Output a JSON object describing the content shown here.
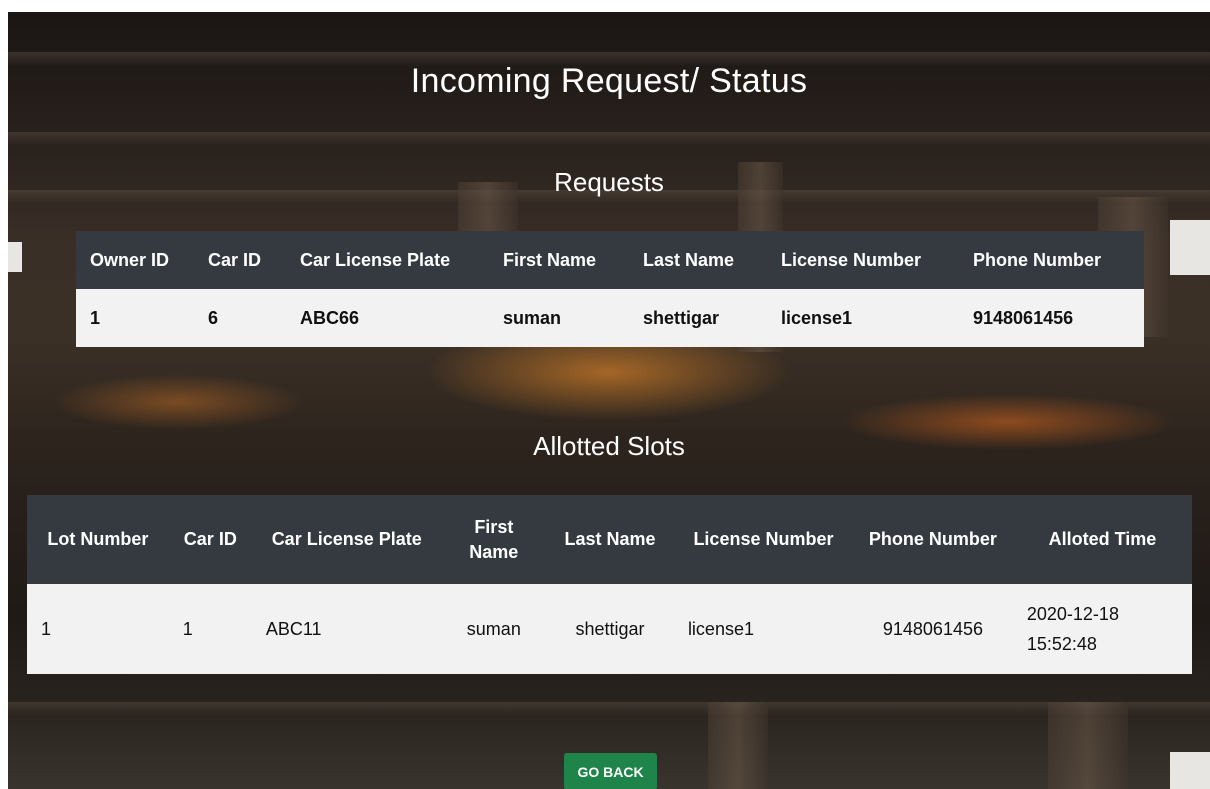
{
  "page": {
    "title": "Incoming Request/ Status"
  },
  "requests": {
    "heading": "Requests",
    "columns": [
      "Owner ID",
      "Car ID",
      "Car License Plate",
      "First Name",
      "Last Name",
      "License Number",
      "Phone Number"
    ],
    "rows": [
      [
        "1",
        "6",
        "ABC66",
        "suman",
        "shettigar",
        "license1",
        "9148061456"
      ]
    ]
  },
  "allotted": {
    "heading": "Allotted Slots",
    "columns": [
      "Lot Number",
      "Car ID",
      "Car License Plate",
      "First Name",
      "Last Name",
      "License Number",
      "Phone Number",
      "Alloted Time"
    ],
    "rows": [
      [
        "1",
        "1",
        "ABC11",
        "suman",
        "shettigar",
        "license1",
        "9148061456",
        "2020-12-18 15:52:48"
      ]
    ]
  },
  "actions": {
    "go_back_label": "GO BACK"
  },
  "colors": {
    "table_header": "#343a40",
    "table_row": "#f2f2f2",
    "go_back_button": "#1e8449"
  }
}
